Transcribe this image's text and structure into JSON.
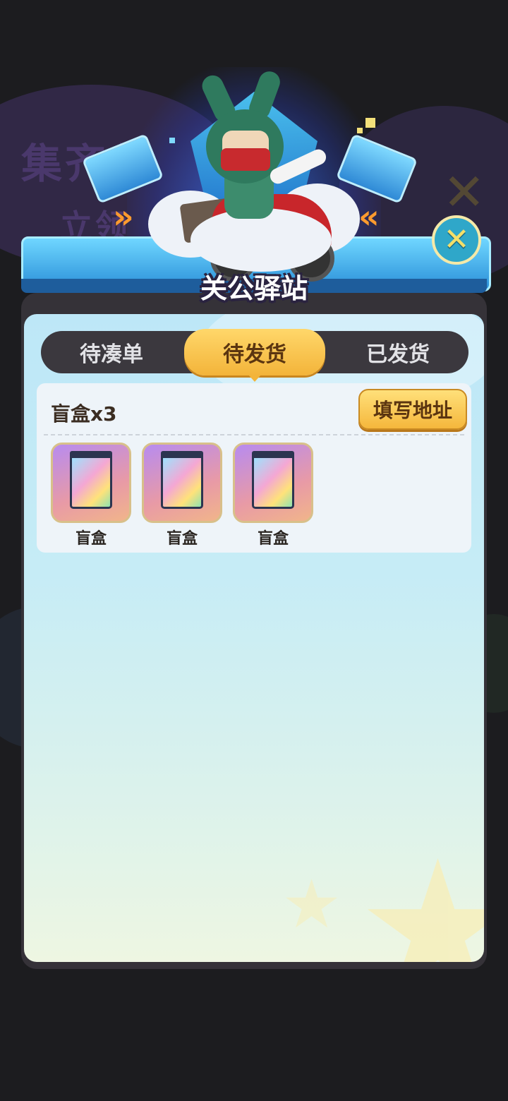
{
  "header": {
    "title": "关公驿站"
  },
  "tabs": [
    {
      "label": "待凑单",
      "active": false
    },
    {
      "label": "待发货",
      "active": true
    },
    {
      "label": "已发货",
      "active": false
    }
  ],
  "order": {
    "title": "盲盒x3",
    "address_button": "填写地址",
    "items": [
      {
        "label": "盲盒",
        "icon": "blind-box-icon"
      },
      {
        "label": "盲盒",
        "icon": "blind-box-icon"
      },
      {
        "label": "盲盒",
        "icon": "blind-box-icon"
      }
    ]
  },
  "background": {
    "text1": "集齐任",
    "text2": "立领"
  },
  "colors": {
    "tab_active": "#f3b43a",
    "tab_bar": "#3b383e",
    "panel_top": "#bde7f7",
    "close_button": "#2fa7c9"
  }
}
